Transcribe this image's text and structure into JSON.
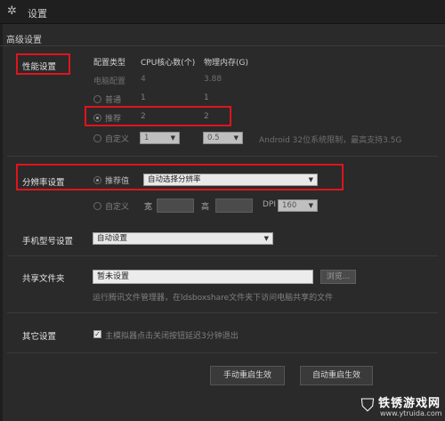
{
  "window": {
    "title": "设置"
  },
  "section_title": "高级设置",
  "performance": {
    "label": "性能设置",
    "col_type": "配置类型",
    "col_cpu": "CPU核心数(个)",
    "col_mem": "物理内存(G)",
    "rows": [
      {
        "name": "电脑配置",
        "cpu": "4",
        "mem": "3.88"
      },
      {
        "name": "普通",
        "cpu": "1",
        "mem": "1"
      },
      {
        "name": "推荐",
        "cpu": "2",
        "mem": "2"
      }
    ],
    "custom_label": "自定义",
    "custom_cpu": "1",
    "custom_mem": "0.5",
    "note": "Android 32位系统限制，最高支持3.5G"
  },
  "resolution": {
    "label": "分辨率设置",
    "recommended_label": "推荐值",
    "recommended_value": "自动选择分辨率",
    "custom_label": "自定义",
    "width_label": "宽",
    "height_label": "高",
    "dpi_label": "DPI",
    "dpi_value": "160"
  },
  "phone_model": {
    "label": "手机型号设置",
    "value": "自动设置"
  },
  "shared_folder": {
    "label": "共享文件夹",
    "path": "暂未设置",
    "browse_label": "浏览...",
    "hint": "运行腾讯文件管理器，在ldsboxshare文件夹下访问电脑共享的文件"
  },
  "other": {
    "label": "其它设置",
    "checkbox_label": "主模拟器点击关闭按钮延迟3分钟退出",
    "checked": true
  },
  "buttons": {
    "manual_restart": "手动重启生效",
    "auto_restart": "自动重启生效"
  },
  "watermark": {
    "name": "铁锈游戏网",
    "url": "www.ytruida.com"
  }
}
